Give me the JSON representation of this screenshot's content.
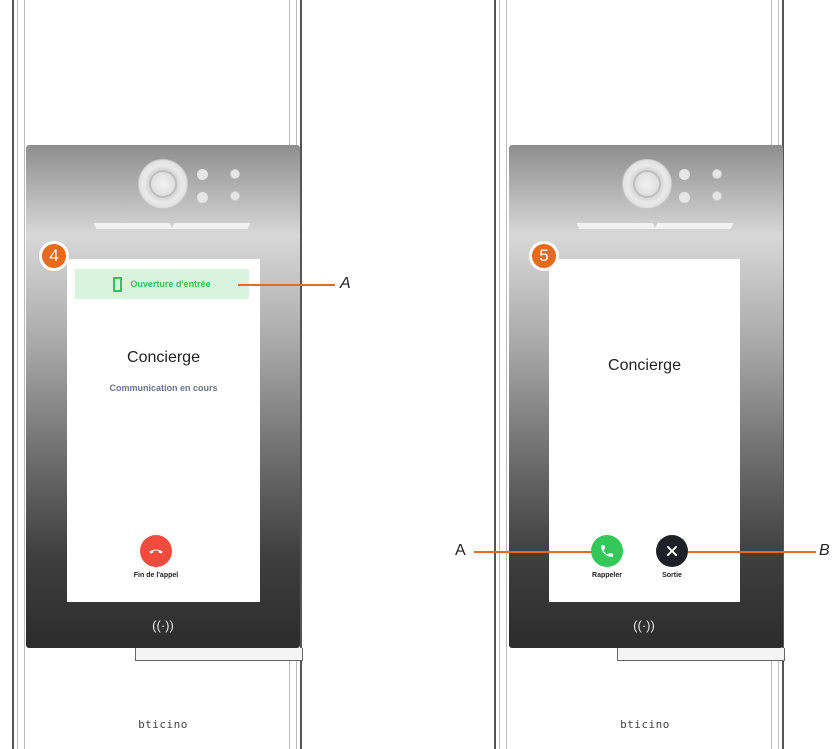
{
  "colors": {
    "accent_orange": "#e86a1c",
    "door_green": "#3cbf5a",
    "door_bg": "#d9f3df",
    "end_call_red": "#f04b3c",
    "recall_green": "#34c759",
    "exit_dark": "#1f2027",
    "status_text": "#6a7394"
  },
  "panel_left": {
    "step": "4",
    "door_open_label": "Ouverture d'entrée",
    "caller": "Concierge",
    "status": "Communication en cours",
    "end_call_label": "Fin de l'appel",
    "nfc_symbol": "((·))",
    "brand": "bticino",
    "callout_a": "A",
    "icons": {
      "door": "door-icon",
      "end_call": "phone-hangup-icon",
      "nfc": "nfc-icon"
    }
  },
  "panel_right": {
    "step": "5",
    "caller": "Concierge",
    "recall_label": "Rappeler",
    "exit_label": "Sortie",
    "nfc_symbol": "((·))",
    "brand": "bticino",
    "callout_a": "A",
    "callout_b": "B",
    "icons": {
      "recall": "phone-icon",
      "exit": "close-icon",
      "nfc": "nfc-icon"
    }
  }
}
